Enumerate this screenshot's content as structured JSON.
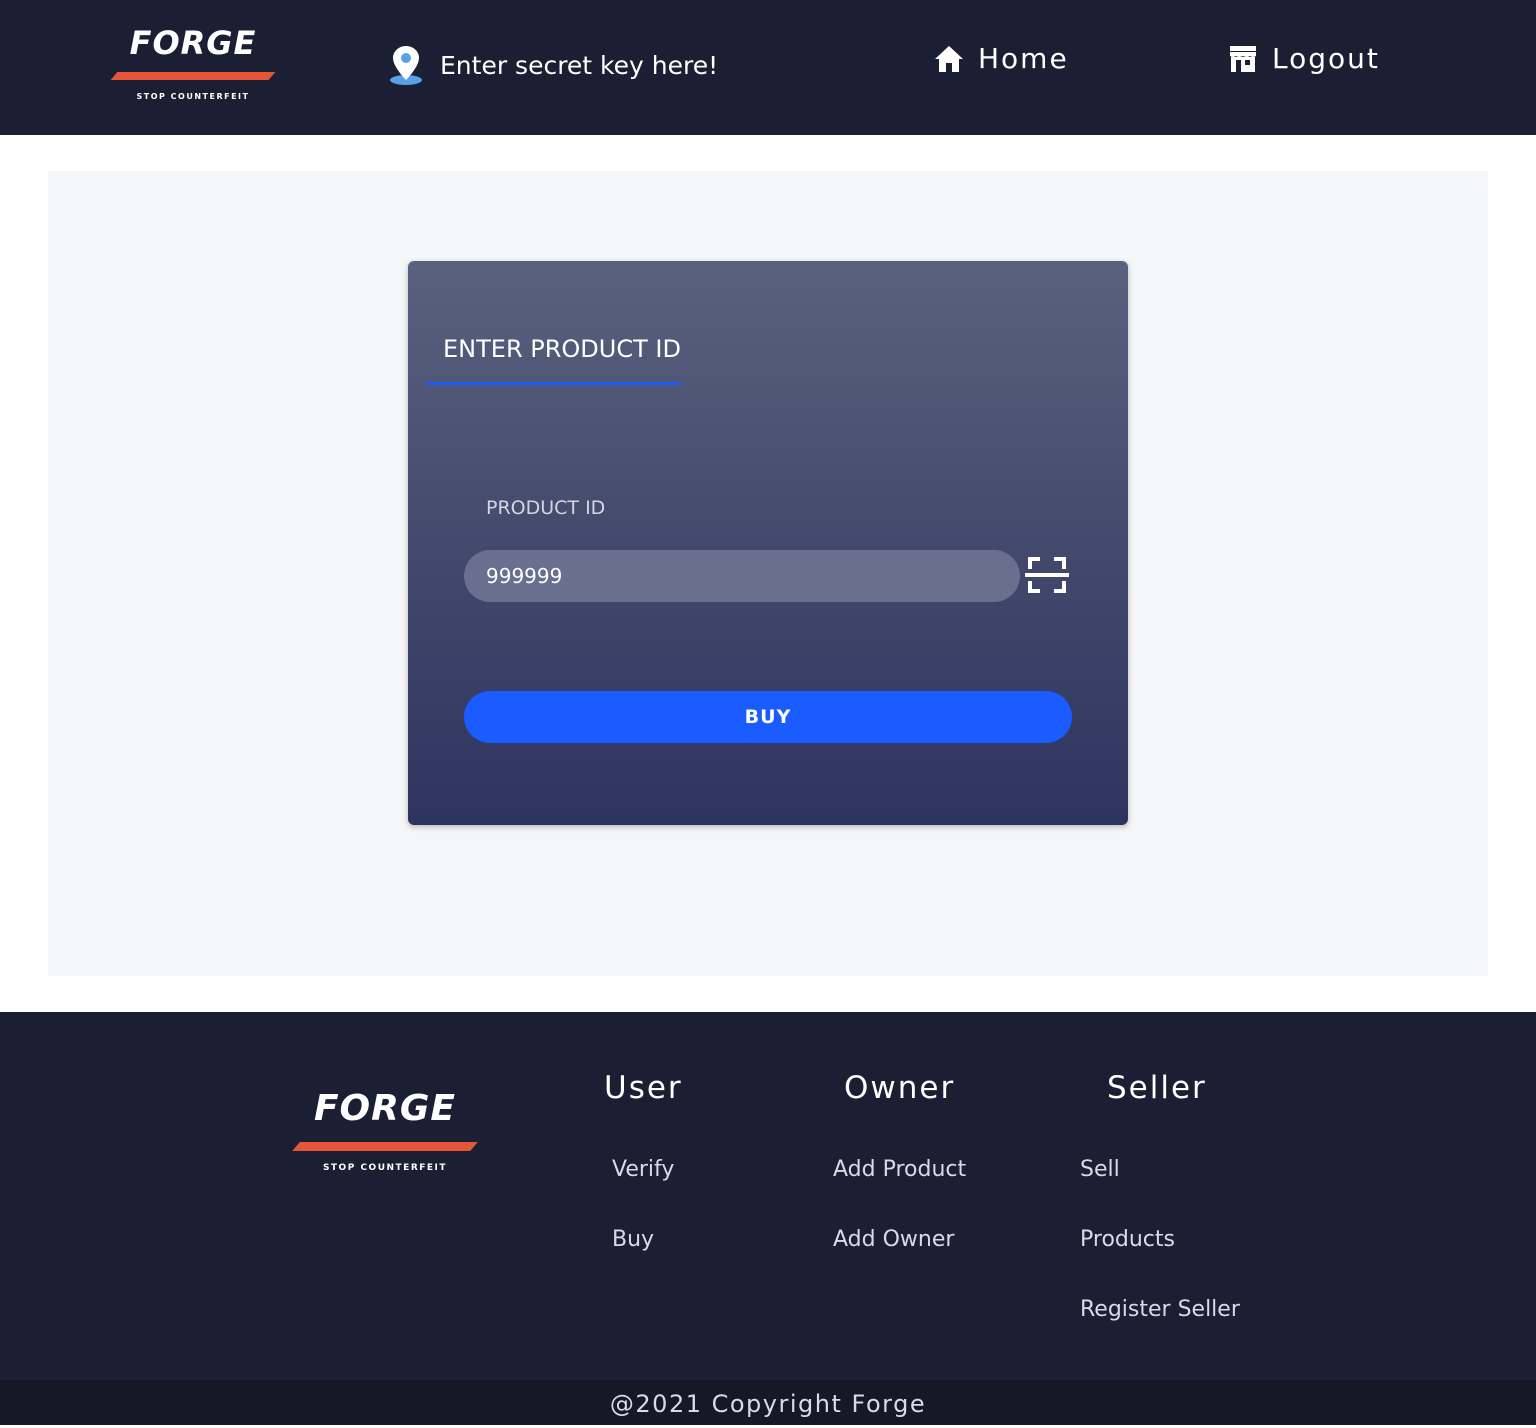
{
  "header": {
    "logo": {
      "word": "FORGE",
      "tagline": "STOP COUNTERFEIT"
    },
    "secret_key_placeholder": "Enter secret key here!",
    "nav": {
      "home": "Home",
      "logout": "Logout"
    }
  },
  "form": {
    "title": "ENTER PRODUCT ID",
    "field_label": "PRODUCT ID",
    "product_id_value": "999999",
    "buy_label": "BUY"
  },
  "footer": {
    "logo": {
      "word": "FORGE",
      "tagline": "STOP COUNTERFEIT"
    },
    "columns": [
      {
        "heading": "User",
        "links": [
          "Verify",
          "Buy"
        ]
      },
      {
        "heading": "Owner",
        "links": [
          "Add Product",
          "Add Owner"
        ]
      },
      {
        "heading": "Seller",
        "links": [
          "Sell",
          "Products",
          "Register Seller"
        ]
      }
    ],
    "copyright": "@2021 Copyright Forge"
  },
  "colors": {
    "header_bg": "#1a1f33",
    "accent_orange": "#e5553a",
    "primary_blue": "#1a5cff",
    "main_bg": "#f5f6f8"
  },
  "icons": {
    "secret": "map-pin-icon",
    "home": "home-icon",
    "logout": "store-icon",
    "scan": "scan-icon"
  }
}
